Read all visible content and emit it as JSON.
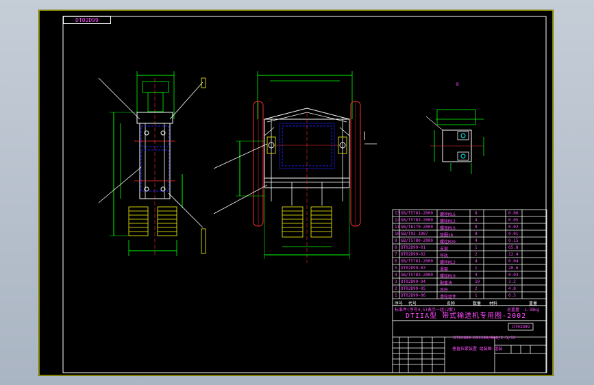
{
  "window": {
    "title": "DTIIA型 带式输送机专用图-2002"
  },
  "colors": {
    "background": "#000000",
    "border": "#ffff00",
    "text": "#ff4dff",
    "frame": "#ffffff",
    "green": "#00ff00",
    "blue": "#2020ff",
    "red": "#ff3030",
    "cyan": "#00ffff"
  },
  "drawing": {
    "sheet_code": "DT02D99",
    "top_label": "B",
    "bom_rows": [
      {
        "no": "13",
        "code": "GB/T5781-2000",
        "name": "螺栓M16",
        "qty": "8",
        "weight": "0.06"
      },
      {
        "no": "12",
        "code": "GB/T5783-2000",
        "name": "螺栓M12",
        "qty": "4",
        "weight": "0.05"
      },
      {
        "no": "11",
        "code": "GB/T6170-2000",
        "name": "螺母M16",
        "qty": "8",
        "weight": "0.02"
      },
      {
        "no": "10",
        "code": "GB/T93-1987",
        "name": "垫圈16",
        "qty": "8",
        "weight": "0.01"
      },
      {
        "no": "9",
        "code": "GB/T5780-2000",
        "name": "螺栓M20",
        "qty": "4",
        "weight": "0.15"
      },
      {
        "no": "8",
        "code": "DT02D99-01",
        "name": "支架",
        "qty": "1",
        "weight": "65.8"
      },
      {
        "no": "7",
        "code": "DT02D99-02",
        "name": "导轨",
        "qty": "2",
        "weight": "12.4"
      },
      {
        "no": "6",
        "code": "GB/T5781-2000",
        "name": "螺栓M12",
        "qty": "4",
        "weight": "0.04"
      },
      {
        "no": "5",
        "code": "DT02D99-03",
        "name": "滑架",
        "qty": "1",
        "weight": "20.6"
      },
      {
        "no": "4",
        "code": "GB/T5783-2000",
        "name": "螺栓M10",
        "qty": "4",
        "weight": "0.03"
      },
      {
        "no": "3",
        "code": "DT02D99-04",
        "name": "配重块",
        "qty": "10",
        "weight": "3.2"
      },
      {
        "no": "2",
        "code": "DT02D99-05",
        "name": "吊杆",
        "qty": "2",
        "weight": "4.8"
      },
      {
        "no": "1",
        "code": "DT02D99-06",
        "name": "滑轮组件",
        "qty": "1",
        "weight": "6.5"
      }
    ],
    "bom_header": {
      "no": "序号",
      "code": "代号",
      "name": "名称",
      "qty": "数量",
      "material": "材料",
      "weight": "重量"
    },
    "note_row": "标准件(序号4,5)表示一组(2套)",
    "weight_total": "总重量 -1.38kg",
    "main_title": "DTIIA型 带式输送机专用图-2002",
    "code_box": "DT02D99",
    "product_code": "DT02D99-DS1300/800/2.5/15",
    "product_name": "垂直拉紧装置 组装图 组装"
  }
}
